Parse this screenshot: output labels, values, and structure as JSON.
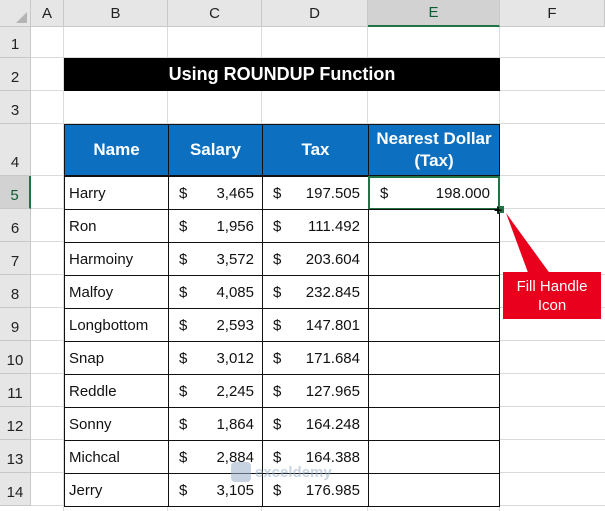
{
  "columns": [
    "A",
    "B",
    "C",
    "D",
    "E",
    "F"
  ],
  "rows": [
    "1",
    "2",
    "3",
    "4",
    "5",
    "6",
    "7",
    "8",
    "9",
    "10",
    "11",
    "12",
    "13",
    "14"
  ],
  "title": "Using ROUNDUP Function",
  "headers": {
    "name": "Name",
    "salary": "Salary",
    "tax": "Tax",
    "nearest_line1": "Nearest Dollar",
    "nearest_line2": "(Tax)"
  },
  "currency": "$",
  "table": [
    {
      "name": "Harry",
      "salary": "3,465",
      "tax": "197.505",
      "nearest": "198.000"
    },
    {
      "name": "Ron",
      "salary": "1,956",
      "tax": "111.492",
      "nearest": ""
    },
    {
      "name": "Harmoiny",
      "salary": "3,572",
      "tax": "203.604",
      "nearest": ""
    },
    {
      "name": "Malfoy",
      "salary": "4,085",
      "tax": "232.845",
      "nearest": ""
    },
    {
      "name": "Longbottom",
      "salary": "2,593",
      "tax": "147.801",
      "nearest": ""
    },
    {
      "name": "Snap",
      "salary": "3,012",
      "tax": "171.684",
      "nearest": ""
    },
    {
      "name": "Reddle",
      "salary": "2,245",
      "tax": "127.965",
      "nearest": ""
    },
    {
      "name": "Sonny",
      "salary": "1,864",
      "tax": "164.248",
      "nearest": ""
    },
    {
      "name": "Michcal",
      "salary": "2,884",
      "tax": "164.388",
      "nearest": ""
    },
    {
      "name": "Jerry",
      "salary": "3,105",
      "tax": "176.985",
      "nearest": ""
    }
  ],
  "callout": {
    "line1": "Fill Handle",
    "line2": "Icon"
  },
  "watermark": "exceldemy",
  "colors": {
    "header_blue": "#0c6fc0",
    "selection_green": "#217346",
    "callout_red": "#e8001c"
  }
}
